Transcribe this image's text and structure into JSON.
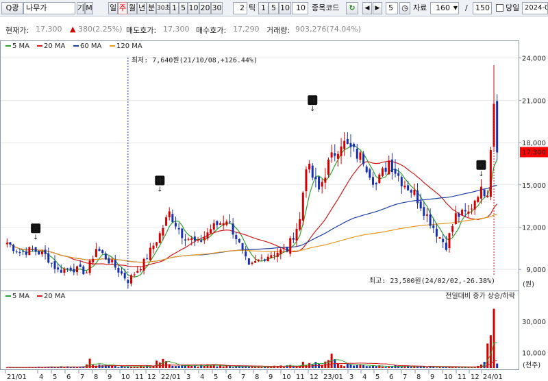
{
  "toolbar": {
    "search_icon_label": "Q",
    "tool_label": "광",
    "stock_name": "나무가",
    "kind_labels": [
      "기",
      "M"
    ],
    "period_tabs": [
      {
        "label": "일",
        "selected": false
      },
      {
        "label": "주",
        "selected": true
      },
      {
        "label": "월",
        "selected": false
      },
      {
        "label": "년",
        "selected": false
      },
      {
        "label": "분",
        "selected": false
      },
      {
        "label": "30초",
        "selected": false
      },
      {
        "label": "1",
        "selected": false
      },
      {
        "label": "5",
        "selected": false
      },
      {
        "label": "10",
        "selected": false
      },
      {
        "label": "20",
        "selected": false
      },
      {
        "label": "30",
        "selected": false
      }
    ],
    "minute_value": "2",
    "tick_label": "틱",
    "tick_tabs": [
      "1",
      "5",
      "10"
    ],
    "tick_value": "10",
    "code_label": "종목코드",
    "step_value": "5",
    "data_label": "자료",
    "data_count": "160",
    "slash": "/",
    "total_count": "150",
    "today_label": "당일",
    "date_value": "2024-0"
  },
  "info": {
    "price_label": "현재가:",
    "price": "17,300",
    "change_arrow": "▲",
    "change": "380(2.25%)",
    "ask_label": "매도호가:",
    "ask": "17,300",
    "bid_label": "매수호가:",
    "bid": "17,290",
    "volume_label": "거래량:",
    "volume": "903,276(74.04%)"
  },
  "colors": {
    "up": "#d40000",
    "down": "#1830b0",
    "ma5": "#2ca02c",
    "ma20": "#cc1a1a",
    "ma60": "#1e3fa0",
    "ma120": "#e69920",
    "current": "#ff0000"
  },
  "price_legend": [
    {
      "label": "5 MA",
      "color": "#2ca02c"
    },
    {
      "label": "20 MA",
      "color": "#cc1a1a"
    },
    {
      "label": "60 MA",
      "color": "#1e3fa0"
    },
    {
      "label": "120 MA",
      "color": "#e69920"
    }
  ],
  "volume_legend": [
    {
      "label": "5 MA",
      "color": "#2ca02c"
    },
    {
      "label": "20 MA",
      "color": "#cc1a1a"
    }
  ],
  "volume_note": "전일대비 증가 상승/하락",
  "annotations": {
    "low": "최저: 7,640원(21/10/08,+126.44%)",
    "high": "최고: 23,500원(24/02/02,-26.38%)",
    "markers": [
      "권",
      "배",
      "배",
      "배"
    ]
  },
  "price_axis": {
    "ticks": [
      "24,000",
      "21,000",
      "18,000",
      "15,000",
      "12,000",
      "9,000"
    ],
    "unit": "(원)",
    "current": "17,300"
  },
  "volume_axis": {
    "ticks": [
      "30,000",
      "10,000"
    ],
    "unit": "(천주)"
  },
  "x_ticks": [
    "21/01",
    "4",
    "5",
    "6",
    "7",
    "8",
    "9",
    "10",
    "11",
    "12",
    "22/01",
    "3",
    "4",
    "5",
    "6",
    "7",
    "8",
    "9",
    "10",
    "11",
    "12",
    "23/01",
    "3",
    "4",
    "5",
    "6",
    "7",
    "8",
    "9",
    "10",
    "11",
    "12",
    "24/01"
  ],
  "chart_data": {
    "type": "candlestick",
    "period": "weekly",
    "price_range": [
      7500,
      25200
    ],
    "volume_range": [
      0,
      40000
    ],
    "current_price": 17300,
    "low": {
      "price": 7640,
      "date": "21/10/08"
    },
    "high": {
      "price": 23500,
      "date": "24/02/02"
    },
    "price_path": [
      [
        0,
        10900
      ],
      [
        4,
        10200
      ],
      [
        8,
        10400
      ],
      [
        12,
        10000
      ],
      [
        16,
        8900
      ],
      [
        20,
        9100
      ],
      [
        25,
        8800
      ],
      [
        28,
        10500
      ],
      [
        33,
        9400
      ],
      [
        38,
        8200
      ],
      [
        43,
        9500
      ],
      [
        48,
        11500
      ],
      [
        51,
        13000
      ],
      [
        55,
        11500
      ],
      [
        60,
        10800
      ],
      [
        64,
        11900
      ],
      [
        69,
        12600
      ],
      [
        72,
        11300
      ],
      [
        76,
        9100
      ],
      [
        80,
        9800
      ],
      [
        84,
        10200
      ],
      [
        88,
        10400
      ],
      [
        92,
        12500
      ],
      [
        94,
        16500
      ],
      [
        98,
        14600
      ],
      [
        101,
        16500
      ],
      [
        105,
        18100
      ],
      [
        109,
        17300
      ],
      [
        112,
        16800
      ],
      [
        116,
        15000
      ],
      [
        120,
        16700
      ],
      [
        124,
        15300
      ],
      [
        128,
        14400
      ],
      [
        131,
        13200
      ],
      [
        135,
        11600
      ],
      [
        138,
        10700
      ],
      [
        141,
        12800
      ],
      [
        145,
        13000
      ],
      [
        148,
        14500
      ],
      [
        151,
        14600
      ],
      [
        153,
        21000
      ],
      [
        154,
        17300
      ]
    ],
    "volume_path": [
      [
        0,
        500
      ],
      [
        10,
        600
      ],
      [
        24,
        1000
      ],
      [
        26,
        4500
      ],
      [
        28,
        2500
      ],
      [
        34,
        1200
      ],
      [
        40,
        600
      ],
      [
        46,
        2000
      ],
      [
        47,
        4800
      ],
      [
        50,
        4500
      ],
      [
        52,
        2500
      ],
      [
        58,
        1200
      ],
      [
        64,
        2000
      ],
      [
        70,
        1200
      ],
      [
        80,
        800
      ],
      [
        90,
        1500
      ],
      [
        94,
        4000
      ],
      [
        98,
        2500
      ],
      [
        102,
        9000
      ],
      [
        104,
        3000
      ],
      [
        112,
        2000
      ],
      [
        120,
        1500
      ],
      [
        128,
        1000
      ],
      [
        136,
        600
      ],
      [
        146,
        600
      ],
      [
        150,
        3000
      ],
      [
        152,
        20000
      ],
      [
        153,
        38000
      ],
      [
        154,
        3000
      ]
    ]
  }
}
